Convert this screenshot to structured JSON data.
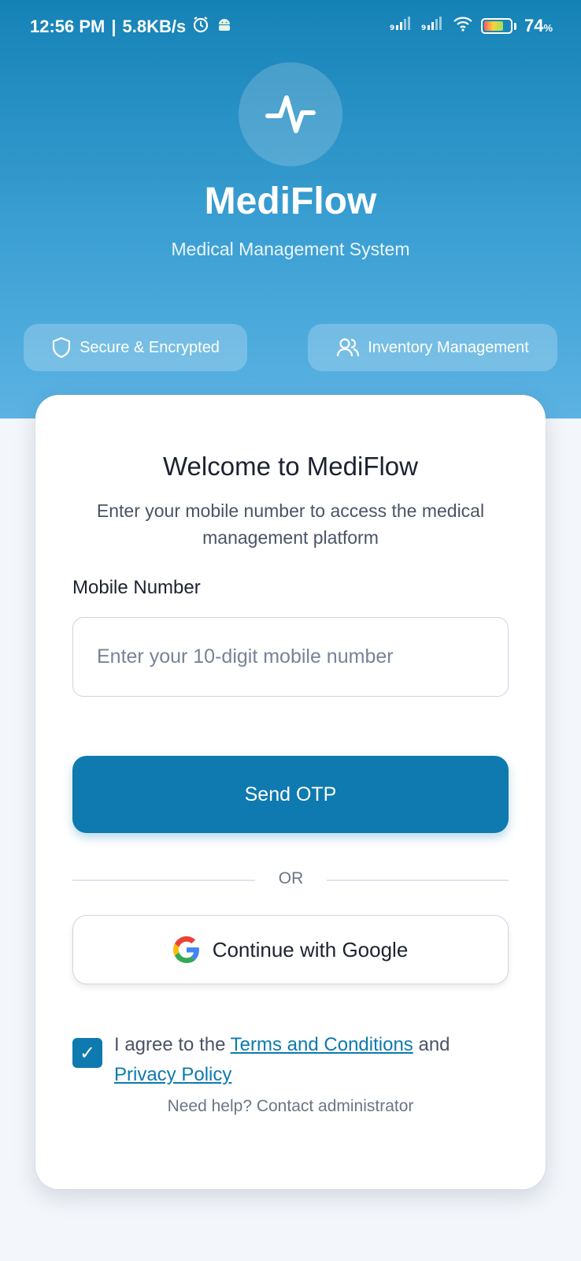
{
  "status_bar": {
    "time": "12:56 PM",
    "net_speed": "5.8KB/s",
    "battery_percent": "74",
    "battery_unit": "%",
    "battery_level": 0.74
  },
  "hero": {
    "app_name": "MediFlow",
    "tagline": "Medical Management System",
    "features": [
      {
        "label": "Secure & Encrypted",
        "icon": "shield-icon"
      },
      {
        "label": "Inventory Management",
        "icon": "users-icon"
      }
    ]
  },
  "card": {
    "welcome": "Welcome to MediFlow",
    "description": "Enter your mobile number to access the medical management platform",
    "mobile_label": "Mobile Number",
    "mobile_placeholder": "Enter your 10-digit mobile number",
    "mobile_value": "",
    "send_otp_label": "Send OTP",
    "divider_label": "OR",
    "google_label": "Continue with Google",
    "agree_checked": true,
    "agree_prefix": "I agree to the ",
    "terms_link": "Terms and Conditions",
    "agree_and": " and",
    "privacy_link": "Privacy Policy",
    "help_text": "Need help? Contact administrator"
  },
  "colors": {
    "primary": "#0e7aaf",
    "hero_top": "#1582b6",
    "hero_bottom": "#5cb3e3",
    "background": "#f3f6fa"
  }
}
